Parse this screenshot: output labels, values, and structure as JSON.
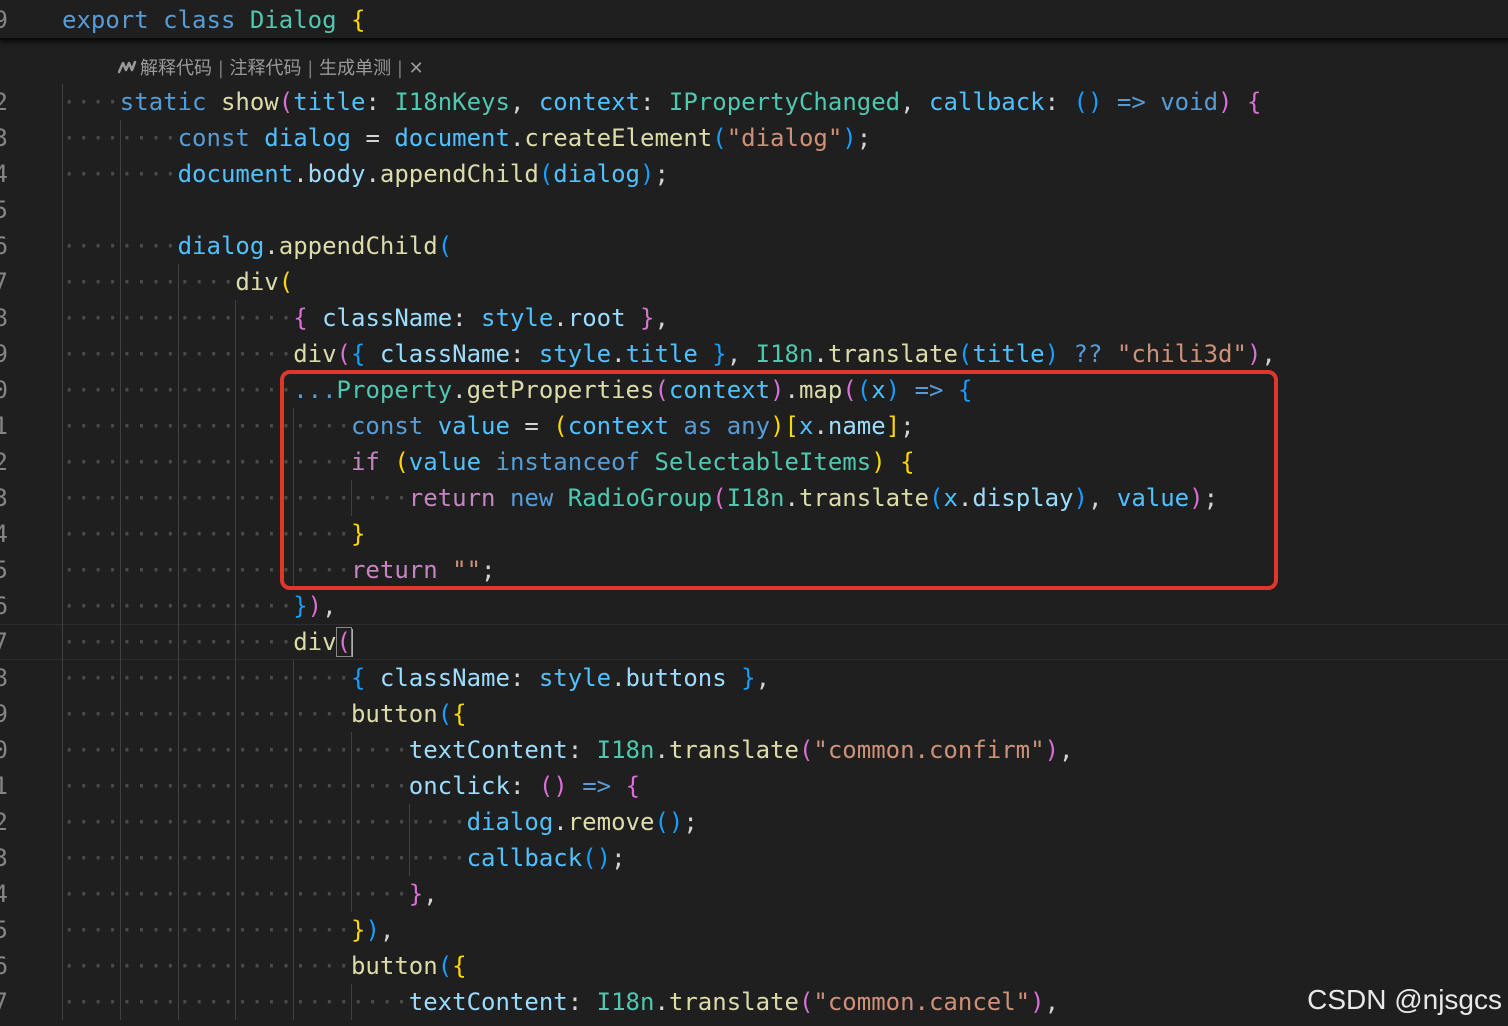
{
  "sticky_header": {
    "line_number": "9",
    "code": "export class Dialog {"
  },
  "codelens": {
    "items": [
      "解释代码",
      "注释代码",
      "生成单测"
    ],
    "separator": "|",
    "icon": "sparkle-icon",
    "close_icon": "close-icon",
    "close_glyph": "✕"
  },
  "lines": [
    {
      "n": "2",
      "text": "static show(title: I18nKeys, context: IPropertyChanged, callback: () => void) {"
    },
    {
      "n": "3",
      "text": "const dialog = document.createElement(\"dialog\");"
    },
    {
      "n": "4",
      "text": "document.body.appendChild(dialog);"
    },
    {
      "n": "5",
      "text": ""
    },
    {
      "n": "6",
      "text": "dialog.appendChild("
    },
    {
      "n": "7",
      "text": "div("
    },
    {
      "n": "8",
      "text": "{ className: style.root },"
    },
    {
      "n": "9",
      "text": "div({ className: style.title }, I18n.translate(title) ?? \"chili3d\"),"
    },
    {
      "n": "0",
      "text": "...Property.getProperties(context).map((x) => {"
    },
    {
      "n": "1",
      "text": "const value = (context as any)[x.name];"
    },
    {
      "n": "2",
      "text": "if (value instanceof SelectableItems) {"
    },
    {
      "n": "3",
      "text": "return new RadioGroup(I18n.translate(x.display), value);"
    },
    {
      "n": "4",
      "text": "}"
    },
    {
      "n": "5",
      "text": "return \"\";"
    },
    {
      "n": "6",
      "text": "}),"
    },
    {
      "n": "7",
      "text": "div("
    },
    {
      "n": "8",
      "text": "{ className: style.buttons },"
    },
    {
      "n": "9",
      "text": "button({"
    },
    {
      "n": "0",
      "text": "textContent: I18n.translate(\"common.confirm\"),"
    },
    {
      "n": "1",
      "text": "onclick: () => {"
    },
    {
      "n": "2",
      "text": "dialog.remove();"
    },
    {
      "n": "3",
      "text": "callback();"
    },
    {
      "n": "4",
      "text": "},"
    },
    {
      "n": "5",
      "text": "}),"
    },
    {
      "n": "6",
      "text": "button({"
    },
    {
      "n": "7",
      "text": "textContent: I18n.translate(\"common.cancel\"),"
    }
  ],
  "watermark": "CSDN @njsgcs",
  "colors": {
    "background": "#1f1f1f",
    "highlight_box": "#e0362e",
    "keyword": "#569cd6",
    "control": "#c586c0",
    "function": "#dcdcaa",
    "type": "#4ec9b0",
    "variable": "#9cdcfe",
    "string": "#ce9178"
  }
}
